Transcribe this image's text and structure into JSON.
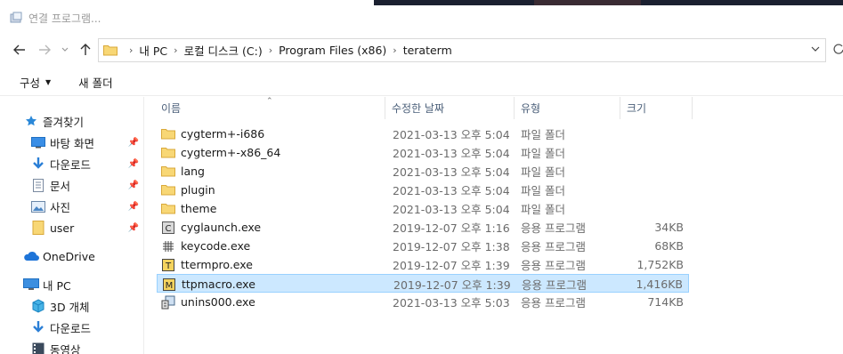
{
  "window": {
    "title": "연결 프로그램..."
  },
  "navigation": {
    "back_icon": "arrow-left-icon",
    "forward_icon": "arrow-right-icon",
    "recent_icon": "chevron-down-icon",
    "up_icon": "arrow-up-icon"
  },
  "address": {
    "crumbs": [
      "내 PC",
      "로컬 디스크 (C:)",
      "Program Files (x86)",
      "teraterm"
    ]
  },
  "toolbar": {
    "organize_label": "구성",
    "new_folder_label": "새 폴더"
  },
  "sidebar": {
    "items": [
      {
        "label": "즐겨찾기",
        "icon": "star-icon"
      },
      {
        "label": "바탕 화면",
        "icon": "desktop-icon",
        "pinned": true
      },
      {
        "label": "다운로드",
        "icon": "download-icon",
        "pinned": true
      },
      {
        "label": "문서",
        "icon": "document-icon",
        "pinned": true
      },
      {
        "label": "사진",
        "icon": "pictures-icon",
        "pinned": true
      },
      {
        "label": "user",
        "icon": "folder-icon",
        "pinned": true
      },
      {
        "label": "OneDrive",
        "icon": "cloud-icon"
      },
      {
        "label": "내 PC",
        "icon": "computer-icon"
      },
      {
        "label": "3D 개체",
        "icon": "cube-icon"
      },
      {
        "label": "다운로드",
        "icon": "download-icon"
      },
      {
        "label": "동영상",
        "icon": "video-icon"
      }
    ]
  },
  "file_list": {
    "columns": {
      "name": "이름",
      "date": "수정한 날짜",
      "type": "유형",
      "size": "크기"
    },
    "rows": [
      {
        "name": "cygterm+-i686",
        "date": "2021-03-13 오후 5:04",
        "type": "파일 폴더",
        "size": "",
        "icon": "folder-icon"
      },
      {
        "name": "cygterm+-x86_64",
        "date": "2021-03-13 오후 5:04",
        "type": "파일 폴더",
        "size": "",
        "icon": "folder-icon"
      },
      {
        "name": "lang",
        "date": "2021-03-13 오후 5:04",
        "type": "파일 폴더",
        "size": "",
        "icon": "folder-icon"
      },
      {
        "name": "plugin",
        "date": "2021-03-13 오후 5:04",
        "type": "파일 폴더",
        "size": "",
        "icon": "folder-icon"
      },
      {
        "name": "theme",
        "date": "2021-03-13 오후 5:04",
        "type": "파일 폴더",
        "size": "",
        "icon": "folder-icon"
      },
      {
        "name": "cyglaunch.exe",
        "date": "2019-12-07 오후 1:16",
        "type": "응용 프로그램",
        "size": "34KB",
        "icon": "cyglaunch-exe-icon"
      },
      {
        "name": "keycode.exe",
        "date": "2019-12-07 오후 1:38",
        "type": "응용 프로그램",
        "size": "68KB",
        "icon": "keycode-exe-icon"
      },
      {
        "name": "ttermpro.exe",
        "date": "2019-12-07 오후 1:39",
        "type": "응용 프로그램",
        "size": "1,752KB",
        "icon": "ttermpro-exe-icon"
      },
      {
        "name": "ttpmacro.exe",
        "date": "2019-12-07 오후 1:39",
        "type": "응용 프로그램",
        "size": "1,416KB",
        "icon": "ttpmacro-exe-icon",
        "selected": true
      },
      {
        "name": "unins000.exe",
        "date": "2021-03-13 오후 5:03",
        "type": "응용 프로그램",
        "size": "714KB",
        "icon": "uninstall-exe-icon"
      }
    ]
  }
}
